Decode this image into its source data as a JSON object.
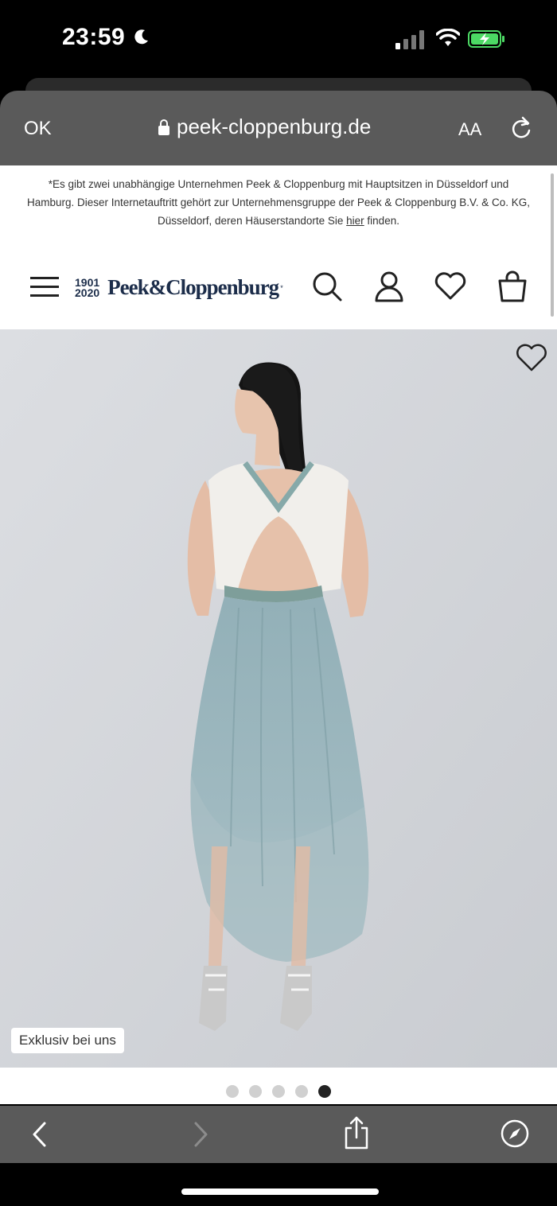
{
  "status_bar": {
    "time": "23:59"
  },
  "browser": {
    "ok_label": "OK",
    "url": "peek-cloppenburg.de",
    "text_size_label": "AA"
  },
  "notice": {
    "text": "*Es gibt zwei unabhängige Unternehmen Peek & Cloppenburg mit Hauptsitzen in Düsseldorf und Hamburg. Dieser Internetauftritt gehört zur Unternehmensgruppe der Peek & Cloppenburg B.V. & Co. KG, Düsseldorf, deren Häuserstandorte Sie ",
    "link": "hier",
    "suffix": " finden."
  },
  "header": {
    "logo_year_top": "1901",
    "logo_year_bottom": "2020",
    "logo_name": "Peek&Cloppenburg",
    "logo_mark": "*"
  },
  "product": {
    "badge": "Exklusiv bei uns",
    "image_count": 5,
    "active_image": 5
  },
  "colors": {
    "brand": "#1c2d4a",
    "browser_chrome": "#5a5a5a",
    "product_bg": "#d6d8dc"
  }
}
